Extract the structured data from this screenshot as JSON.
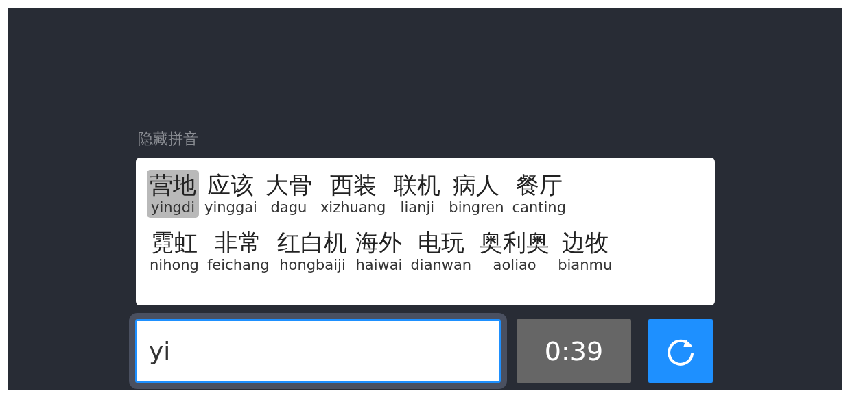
{
  "toggle_label": "隐藏拼音",
  "word_rows": [
    {
      "words": [
        {
          "hanzi": "营地",
          "pinyin": "yingdi",
          "selected": true
        },
        {
          "hanzi": "应该",
          "pinyin": "yinggai",
          "selected": false
        },
        {
          "hanzi": "大骨",
          "pinyin": "dagu",
          "selected": false
        },
        {
          "hanzi": "西装",
          "pinyin": "xizhuang",
          "selected": false
        },
        {
          "hanzi": "联机",
          "pinyin": "lianji",
          "selected": false
        },
        {
          "hanzi": "病人",
          "pinyin": "bingren",
          "selected": false
        },
        {
          "hanzi": "餐厅",
          "pinyin": "canting",
          "selected": false
        }
      ]
    },
    {
      "words": [
        {
          "hanzi": "霓虹",
          "pinyin": "nihong",
          "selected": false
        },
        {
          "hanzi": "非常",
          "pinyin": "feichang",
          "selected": false
        },
        {
          "hanzi": "红白机",
          "pinyin": "hongbaiji",
          "selected": false
        },
        {
          "hanzi": "海外",
          "pinyin": "haiwai",
          "selected": false
        },
        {
          "hanzi": "电玩",
          "pinyin": "dianwan",
          "selected": false
        },
        {
          "hanzi": "奥利奥",
          "pinyin": "aoliao",
          "selected": false
        },
        {
          "hanzi": "边牧",
          "pinyin": "bianmu",
          "selected": false
        }
      ]
    }
  ],
  "input": {
    "value": "yi"
  },
  "timer": "0:39"
}
